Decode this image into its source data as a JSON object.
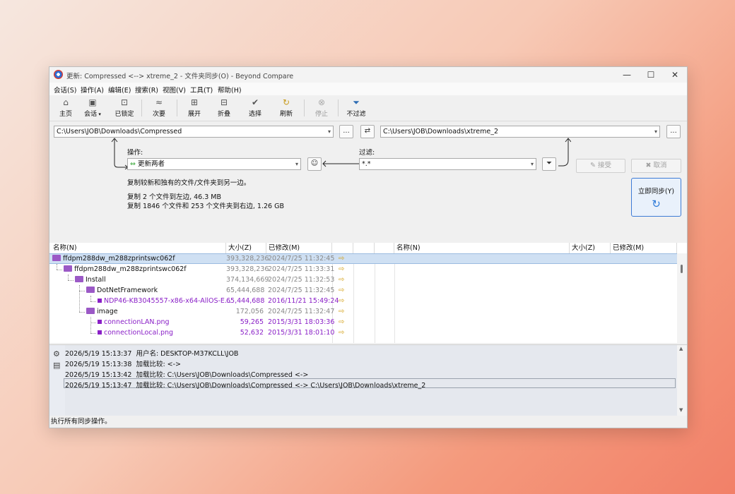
{
  "window": {
    "title": "更新:  Compressed <--> xtreme_2 - 文件夹同步(O) - Beyond Compare",
    "minimize": "—",
    "maximize": "☐",
    "close": "✕"
  },
  "menu": [
    "会话(S)",
    "操作(A)",
    "编辑(E)",
    "搜索(R)",
    "视图(V)",
    "工具(T)",
    "帮助(H)"
  ],
  "toolbar": {
    "home": "主页",
    "sessions": "会话",
    "locked": "已锁定",
    "next_diff": "次要",
    "expand": "展开",
    "collapse": "折叠",
    "select": "选择",
    "refresh": "刷新",
    "stop": "停止",
    "no_filter": "不过滤"
  },
  "paths": {
    "left": "C:\\Users\\JOB\\Downloads\\Compressed",
    "right": "C:\\Users\\JOB\\Downloads\\xtreme_2",
    "browse": "..."
  },
  "action": {
    "label": "操作:",
    "value": "更新两者",
    "description": "复制较新和独有的文件/文件夹到另一边。",
    "summary_line1": "复制 2 个文件到左边, 46.3 MB",
    "summary_line2": "复制 1846 个文件和 253 个文件夹到右边, 1.26 GB"
  },
  "filter": {
    "label": "过滤:",
    "value": "*.*"
  },
  "buttons": {
    "accept": "接受",
    "cancel": "取消",
    "sync_now": "立即同步(Y)"
  },
  "columns": {
    "left": [
      "名称(N)",
      "大小(Z)",
      "已修改(M)"
    ],
    "right": [
      "名称(N)",
      "大小(Z)",
      "已修改(M)"
    ]
  },
  "rows": [
    {
      "name": "ffdpm288dw_m288zprintswc062f",
      "size": "393,328,236",
      "modified": "2024/7/25 11:32:45"
    },
    {
      "name": "ffdpm288dw_m288zprintswc062f",
      "size": "393,328,236",
      "modified": "2024/7/25 11:33:31"
    },
    {
      "name": "Install",
      "size": "374,134,669",
      "modified": "2024/7/25 11:32:53"
    },
    {
      "name": "DotNetFramework",
      "size": "65,444,688",
      "modified": "2024/7/25 11:32:45"
    },
    {
      "name": "NDP46-KB3045557-x86-x64-AllOS-E...",
      "size": "65,444,688",
      "modified": "2016/11/21 15:49:24"
    },
    {
      "name": "image",
      "size": "172,056",
      "modified": "2024/7/25 11:32:47"
    },
    {
      "name": "connectionLAN.png",
      "size": "59,265",
      "modified": "2015/3/31 18:03:36"
    },
    {
      "name": "connectionLocal.png",
      "size": "52,632",
      "modified": "2015/3/31 18:01:10"
    }
  ],
  "log": [
    {
      "time": "2026/5/19 15:13:37",
      "text": "用户名:  DESKTOP-M37KCLL\\JOB"
    },
    {
      "time": "2026/5/19 15:13:38",
      "text": "加载比较:  <->"
    },
    {
      "time": "2026/5/19 15:13:42",
      "text": "加载比较:  C:\\Users\\JOB\\Downloads\\Compressed <->"
    },
    {
      "time": "2026/5/19 15:13:47",
      "text": "加载比较:  C:\\Users\\JOB\\Downloads\\Compressed <-> C:\\Users\\JOB\\Downloads\\xtreme_2"
    }
  ],
  "status": "执行所有同步操作。",
  "colors": {
    "selected_row": "#cfe0f3",
    "newer_file": "#8a20c7",
    "folder": "#9b59c6",
    "sync_border": "#3d7bd6"
  }
}
